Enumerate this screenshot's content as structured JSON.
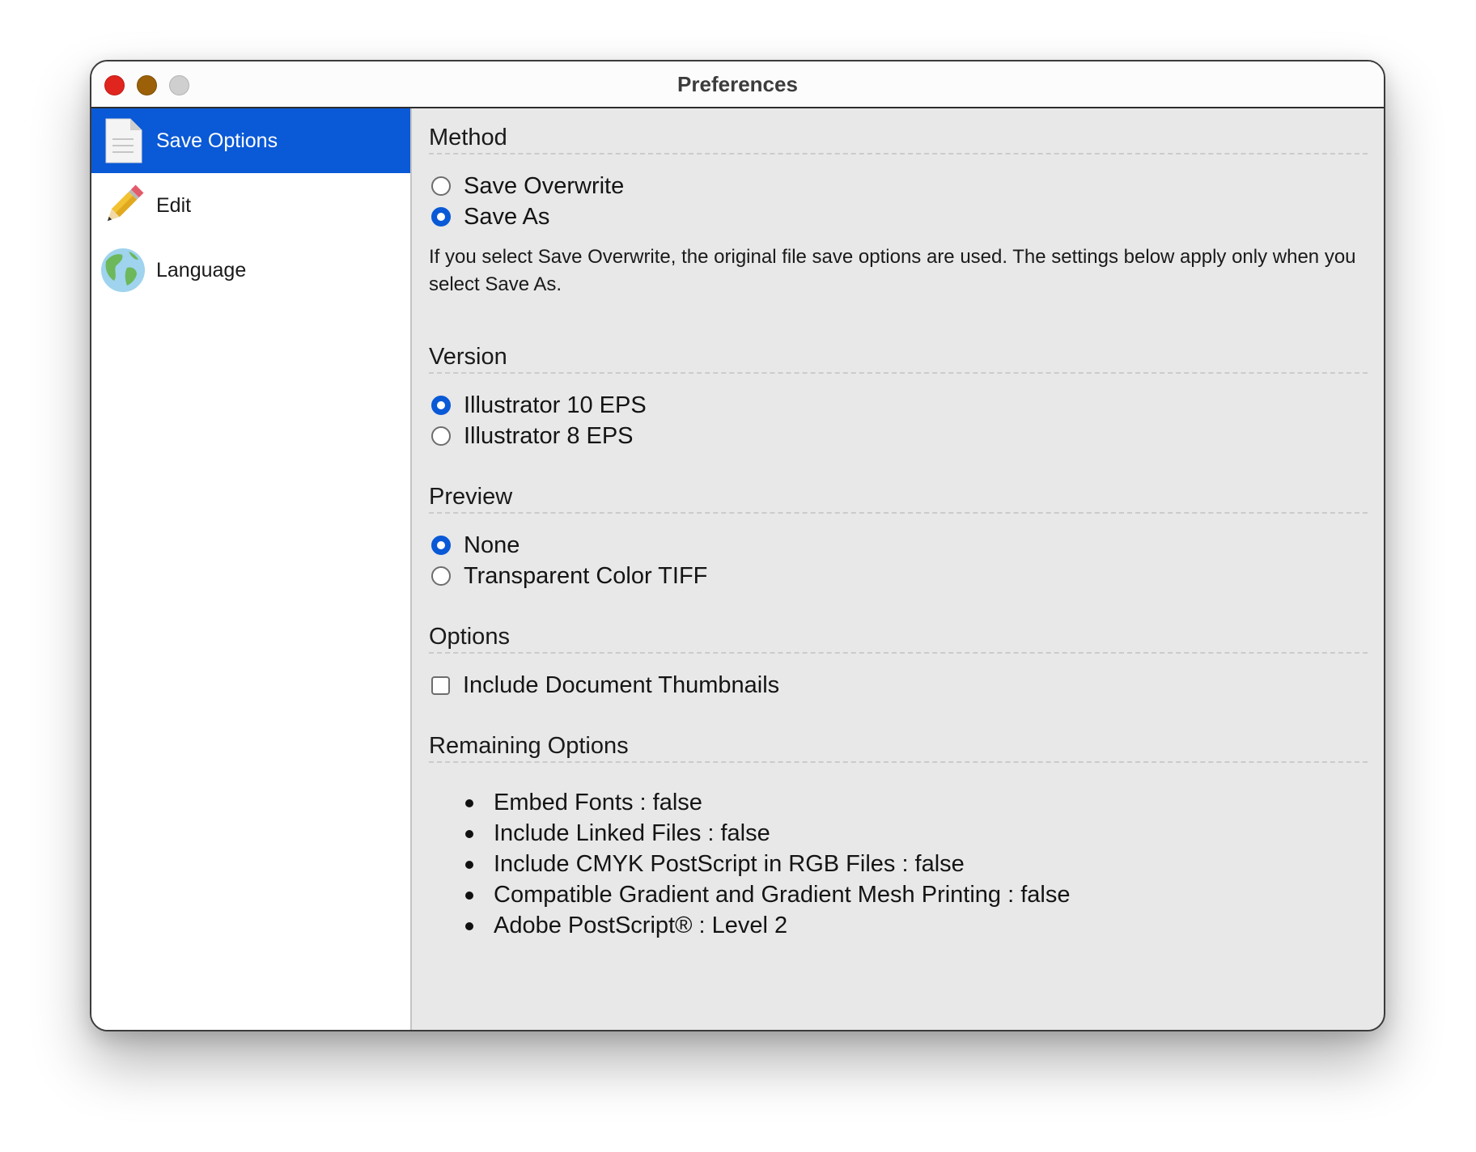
{
  "window": {
    "title": "Preferences"
  },
  "sidebar": {
    "items": [
      {
        "label": "Save Options",
        "icon": "document-icon",
        "selected": true
      },
      {
        "label": "Edit",
        "icon": "pencil-icon",
        "selected": false
      },
      {
        "label": "Language",
        "icon": "globe-icon",
        "selected": false
      }
    ]
  },
  "sections": {
    "method": {
      "title": "Method",
      "options": [
        "Save Overwrite",
        "Save As"
      ],
      "selected": "Save As",
      "note": "If you select Save Overwrite, the original file save options are used. The settings below apply only when you select Save As."
    },
    "version": {
      "title": "Version",
      "options": [
        "Illustrator 10 EPS",
        "Illustrator 8 EPS"
      ],
      "selected": "Illustrator 10 EPS"
    },
    "preview": {
      "title": "Preview",
      "options": [
        "None",
        "Transparent Color TIFF"
      ],
      "selected": "None"
    },
    "options": {
      "title": "Options",
      "checkbox_label": "Include Document Thumbnails",
      "checked": false
    },
    "remaining": {
      "title": "Remaining Options",
      "items": [
        "Embed Fonts : false",
        "Include Linked Files : false",
        "Include CMYK PostScript in RGB Files : false",
        "Compatible Gradient and Gradient Mesh Printing : false",
        "Adobe PostScript® : Level 2"
      ]
    }
  },
  "colors": {
    "accent": "#0a59d6",
    "content_background": "#e8e8e8",
    "sidebar_background": "#ffffff"
  }
}
